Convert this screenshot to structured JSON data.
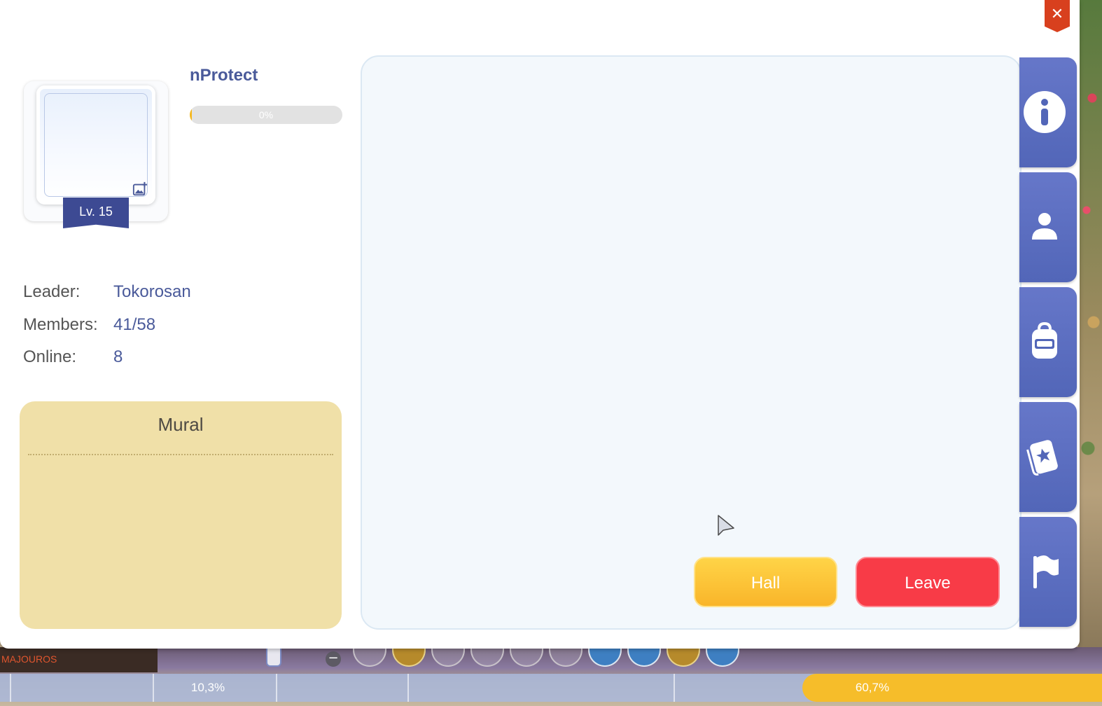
{
  "dialog": {
    "close_label": "✕"
  },
  "guild": {
    "name": "nProtect",
    "level_label": "Lv. 15",
    "progress_text": "0%",
    "progress_fraction": 0.0
  },
  "info": {
    "leader_label": "Leader:",
    "leader_value": "Tokorosan",
    "members_label": "Members:",
    "members_value": "41/58",
    "online_label": "Online:",
    "online_value": "8"
  },
  "mural": {
    "title": "Mural"
  },
  "buttons": {
    "hall": "Hall",
    "leave": "Leave"
  },
  "side_tabs": [
    "info-icon",
    "member-icon",
    "backpack-icon",
    "skill-card-icon",
    "flag-icon"
  ],
  "hud": {
    "left_percent": "10,3%",
    "right_percent": "60,7%",
    "left_text": "MAJOUROS"
  },
  "colors": {
    "accent": "#4a5a9a",
    "tab": "#5266b8",
    "hall": "#f9b52a",
    "leave": "#f83b47",
    "mural_bg": "#f0e0a8",
    "close": "#d8401e"
  }
}
